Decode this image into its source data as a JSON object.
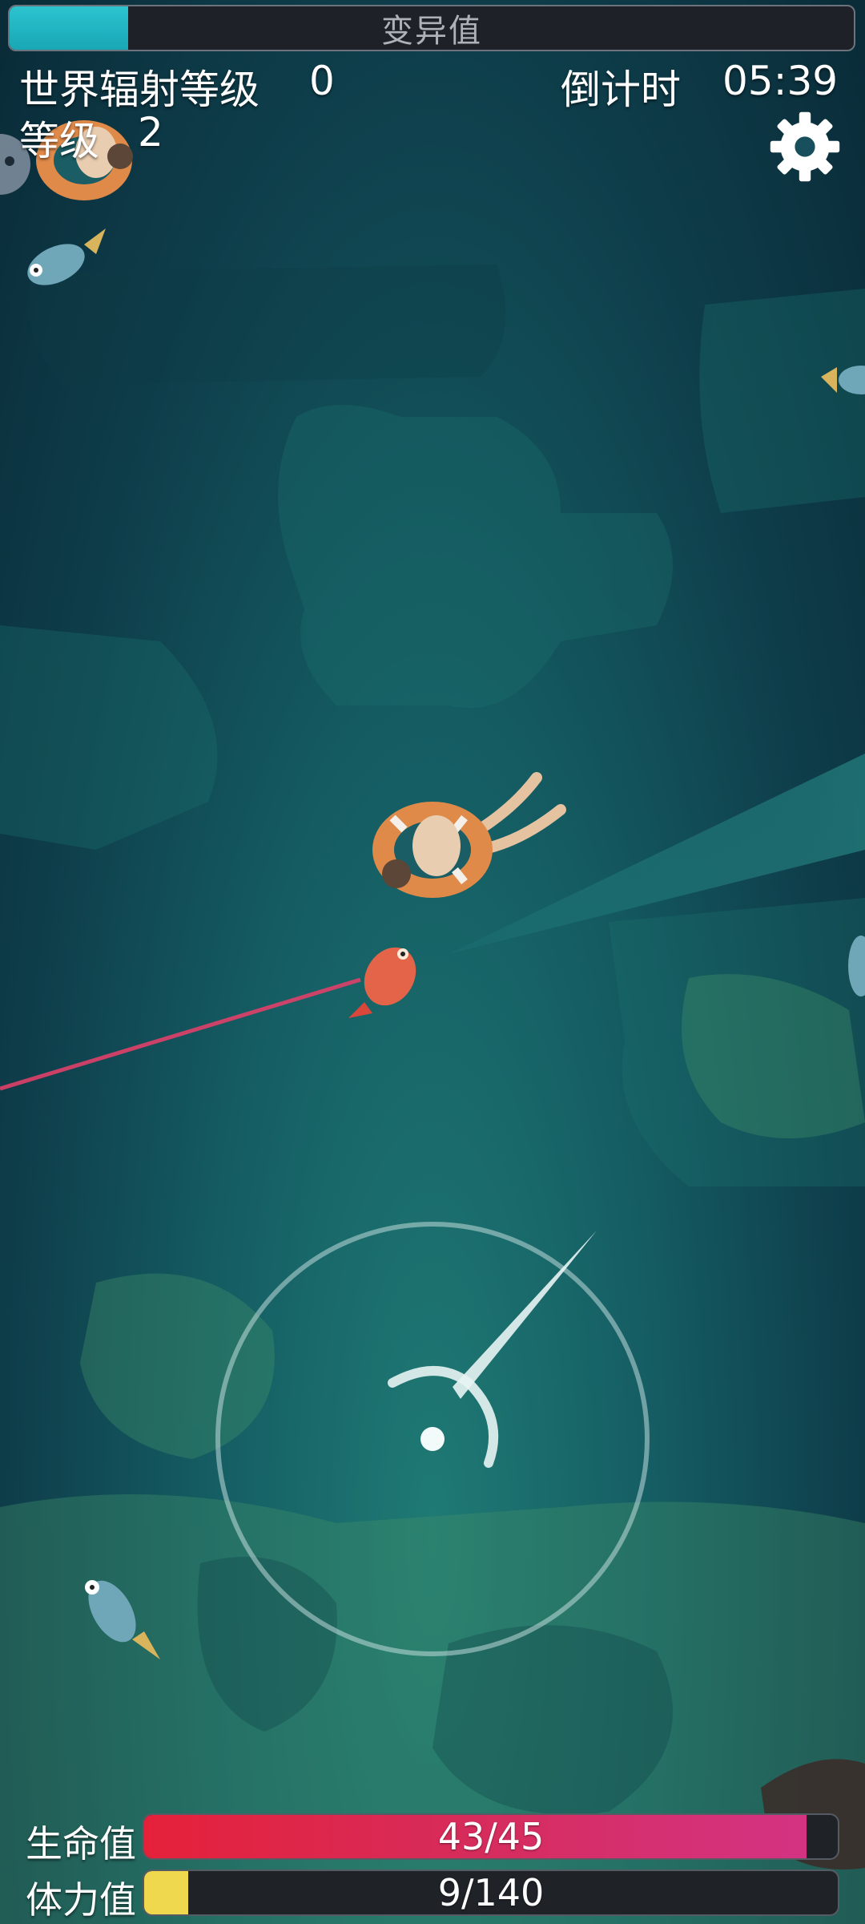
{
  "top_bar": {
    "mutation_label": "变异值",
    "mutation_fraction": 0.14
  },
  "hud": {
    "radiation_label": "世界辐射等级",
    "radiation_value": "0",
    "countdown_label": "倒计时",
    "countdown_value": "05:39",
    "level_label": "等级",
    "level_value": "2"
  },
  "bottom": {
    "hp_label": "生命值",
    "hp_text": "43/45",
    "hp_fraction": 0.9555,
    "stamina_label": "体力值",
    "stamina_text": "9/140",
    "stamina_fraction": 0.064
  },
  "icons": {
    "settings": "gear-icon"
  },
  "colors": {
    "mutation_fill": "#1fb0bd",
    "hp_fill": "#e0234a",
    "stamina_fill": "#f0d84e"
  }
}
